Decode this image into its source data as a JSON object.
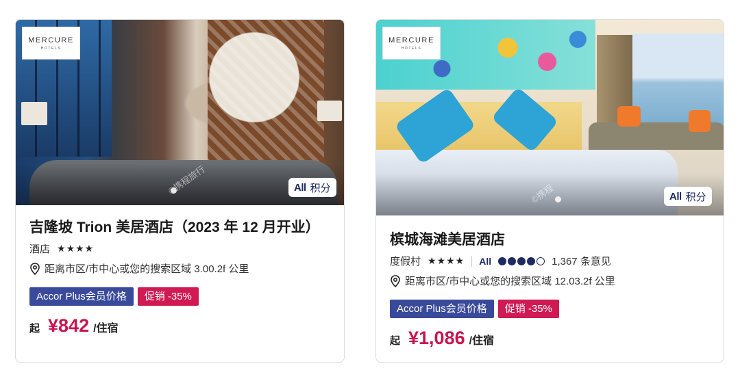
{
  "cards": [
    {
      "brand_logo": {
        "name": "MERCURE",
        "sub": "HOTELS"
      },
      "points_badge": {
        "all": "All",
        "label": "积分"
      },
      "watermark": "©携程旅行",
      "name": "吉隆坡 Trion 美居酒店（2023 年 12 月开业）",
      "type": "酒店",
      "stars": "★★★★",
      "distance": "距离市区/市中心或您的搜索区域 3.00.2f 公里",
      "tags": {
        "member": "Accor Plus会员价格",
        "promo": "促销 -35%"
      },
      "price": {
        "from": "起",
        "amount": "¥842",
        "per": "/住宿"
      }
    },
    {
      "brand_logo": {
        "name": "MERCURE",
        "sub": "HOTELS"
      },
      "points_badge": {
        "all": "All",
        "label": "积分"
      },
      "watermark": "©携程",
      "name": "槟城海滩美居酒店",
      "type": "度假村",
      "stars": "★★★★",
      "rating": {
        "label": "All",
        "score_dots_filled": 4,
        "score_dots_total": 5,
        "reviews": "1,367 条意见"
      },
      "distance": "距离市区/市中心或您的搜索区域 12.03.2f 公里",
      "tags": {
        "member": "Accor Plus会员价格",
        "promo": "促销 -35%"
      },
      "price": {
        "from": "起",
        "amount": "¥1,086",
        "per": "/住宿"
      }
    }
  ]
}
